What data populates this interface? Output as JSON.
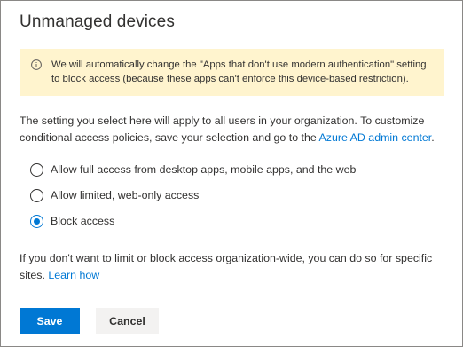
{
  "dialog": {
    "title": "Unmanaged devices"
  },
  "notice": {
    "icon": "info-icon",
    "background": "#fff4ce",
    "text": "We will automatically change the \"Apps that don't use modern authentication\" setting to block access (because these apps can't enforce this device-based restriction)."
  },
  "description": {
    "text": "The setting you select here will apply to all users in your organization. To customize conditional access policies, save your selection and go to the ",
    "link": "Azure AD admin center",
    "suffix": "."
  },
  "options": [
    {
      "label": "Allow full access from desktop apps, mobile apps, and the web",
      "checked": false
    },
    {
      "label": "Allow limited, web-only access",
      "checked": false
    },
    {
      "label": "Block access",
      "checked": true
    }
  ],
  "footer": {
    "text": "If you don't want to limit or block access organization-wide, you can do so for specific sites. ",
    "link": "Learn how"
  },
  "buttons": {
    "save_label": "Save",
    "cancel_label": "Cancel"
  },
  "colors": {
    "accent": "#0078d4",
    "text": "#323130"
  }
}
